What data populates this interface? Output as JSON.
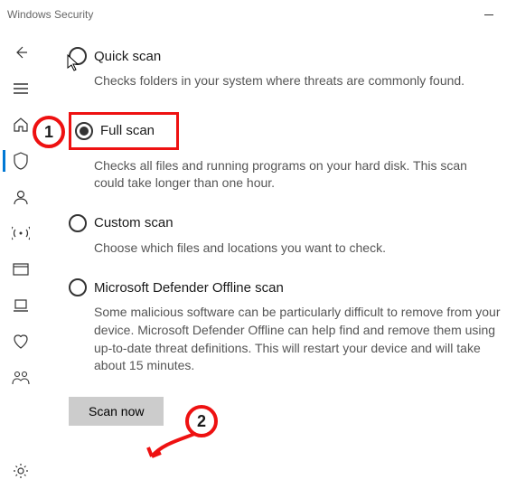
{
  "window": {
    "title": "Windows Security"
  },
  "options": {
    "quick": {
      "title": "Quick scan",
      "desc": "Checks folders in your system where threats are commonly found."
    },
    "full": {
      "title": "Full scan",
      "desc": "Checks all files and running programs on your hard disk. This scan could take longer than one hour."
    },
    "custom": {
      "title": "Custom scan",
      "desc": "Choose which files and locations you want to check."
    },
    "offline": {
      "title": "Microsoft Defender Offline scan",
      "desc": "Some malicious software can be particularly difficult to remove from your device. Microsoft Defender Offline can help find and remove them using up-to-date threat definitions. This will restart your device and will take about 15 minutes."
    }
  },
  "buttons": {
    "scan_now": "Scan now"
  },
  "callouts": {
    "one": "1",
    "two": "2"
  }
}
